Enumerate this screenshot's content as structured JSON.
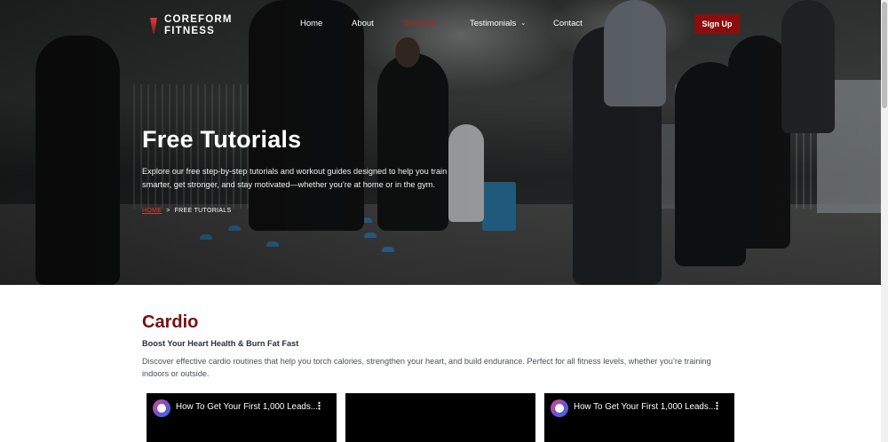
{
  "brand": {
    "line1": "COREFORM",
    "line2": "FITNESS"
  },
  "nav": {
    "items": [
      {
        "label": "Home"
      },
      {
        "label": "About"
      },
      {
        "label": "Services"
      },
      {
        "label": "Testimonials"
      },
      {
        "label": "Contact"
      }
    ],
    "caret": "⌄",
    "signup_label": "Sign Up"
  },
  "hero": {
    "title": "Free Tutorials",
    "description": "Explore our free step-by-step tutorials and workout guides designed to help you train smarter, get stronger, and stay motivated—whether you’re at home or in the gym.",
    "breadcrumb": {
      "home": "HOME",
      "separator": ">",
      "current": "FREE TUTORIALS"
    }
  },
  "section": {
    "title": "Cardio",
    "subtitle": "Boost Your Heart Health & Burn Fat Fast",
    "text": "Discover effective cardio routines that help you torch calories, strengthen your heart, and build endurance. Perfect for all fitness levels, whether you’re training indoors or outside."
  },
  "videos": [
    {
      "title": "How To Get Your First 1,000 Leads...",
      "menu": "⋮"
    },
    {
      "title": "",
      "menu": ""
    },
    {
      "title": "How To Get Your First 1,000 Leads...",
      "menu": "⋮"
    }
  ],
  "colors": {
    "accent": "#8b0d0d",
    "title_red": "#7a0f0f",
    "active_nav": "#b1241f"
  }
}
